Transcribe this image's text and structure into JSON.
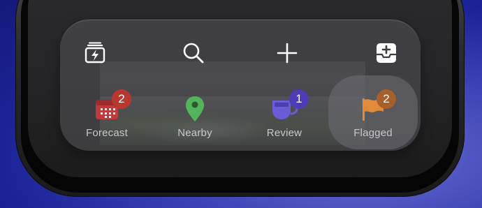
{
  "toolbar": {
    "top_icons": [
      {
        "name": "quick-entry-icon"
      },
      {
        "name": "search-icon"
      },
      {
        "name": "plus-icon"
      },
      {
        "name": "inbox-icon"
      }
    ],
    "tabs": [
      {
        "label": "Forecast",
        "badge": "2",
        "color": "#c0393b",
        "badge_color": "#b8372f"
      },
      {
        "label": "Nearby",
        "badge": "",
        "color": "#54b45c",
        "badge_color": ""
      },
      {
        "label": "Review",
        "badge": "1",
        "color": "#6a5bd6",
        "badge_color": "#4e3bb6"
      },
      {
        "label": "Flagged",
        "badge": "2",
        "color": "#e08a3a",
        "badge_color": "#a8602a",
        "selected": true
      }
    ]
  }
}
